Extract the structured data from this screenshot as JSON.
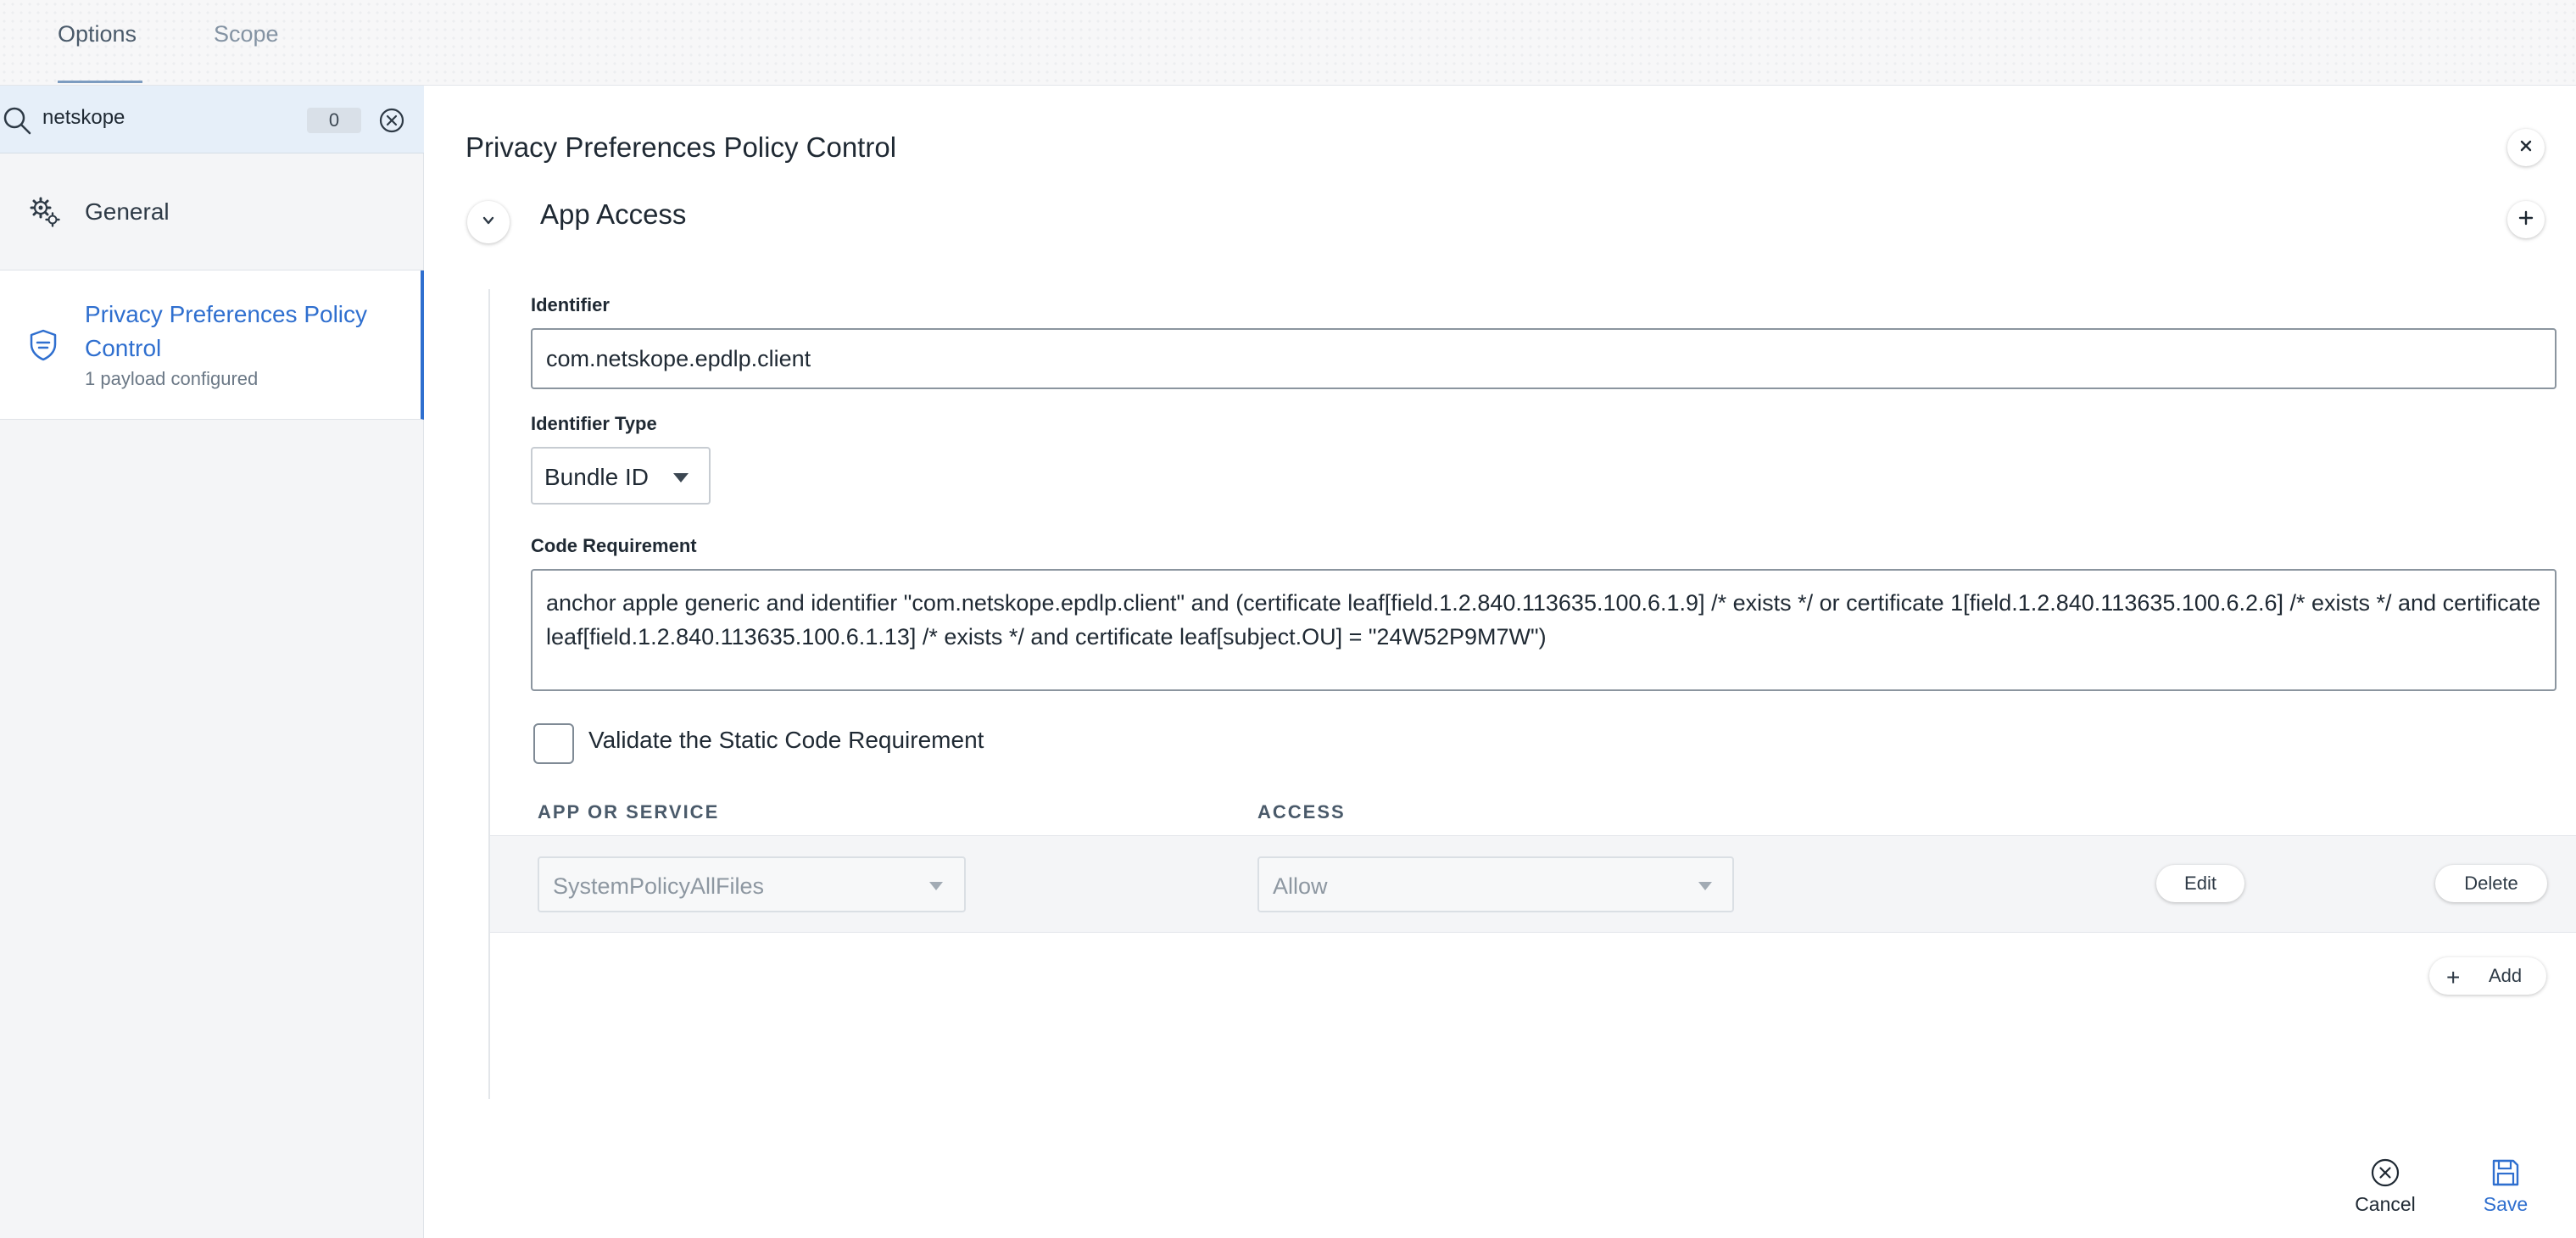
{
  "tabs": [
    {
      "label": "Options",
      "active": true
    },
    {
      "label": "Scope",
      "active": false
    }
  ],
  "sidebar": {
    "search": {
      "value": "netskope",
      "count": "0"
    },
    "items": [
      {
        "label": "General",
        "icon": "gear-icon"
      },
      {
        "label": "Privacy Preferences Policy Control",
        "sub": "1 payload configured",
        "icon": "shield-icon",
        "active": true
      }
    ]
  },
  "main": {
    "title": "Privacy Preferences Policy Control",
    "section_title": "App Access",
    "identifier": {
      "label": "Identifier",
      "value": "com.netskope.epdlp.client"
    },
    "identifier_type": {
      "label": "Identifier Type",
      "value": "Bundle ID"
    },
    "code_requirement": {
      "label": "Code Requirement",
      "value": "anchor apple generic and identifier \"com.netskope.epdlp.client\" and (certificate leaf[field.1.2.840.113635.100.6.1.9] /* exists */ or certificate 1[field.1.2.840.113635.100.6.2.6] /* exists */ and certificate leaf[field.1.2.840.113635.100.6.1.13] /* exists */ and certificate leaf[subject.OU] = \"24W52P9M7W\")"
    },
    "validate_label": "Validate the Static Code Requirement",
    "table": {
      "headers": [
        "APP OR SERVICE",
        "ACCESS"
      ],
      "rows": [
        {
          "service": "SystemPolicyAllFiles",
          "access": "Allow",
          "edit": "Edit",
          "delete": "Delete"
        }
      ]
    },
    "add_label": "Add"
  },
  "footer": {
    "cancel": "Cancel",
    "save": "Save"
  },
  "colors": {
    "accent": "#2f6fcf",
    "sidebar_bg": "#f4f5f7",
    "search_bg": "#e6eff9"
  }
}
